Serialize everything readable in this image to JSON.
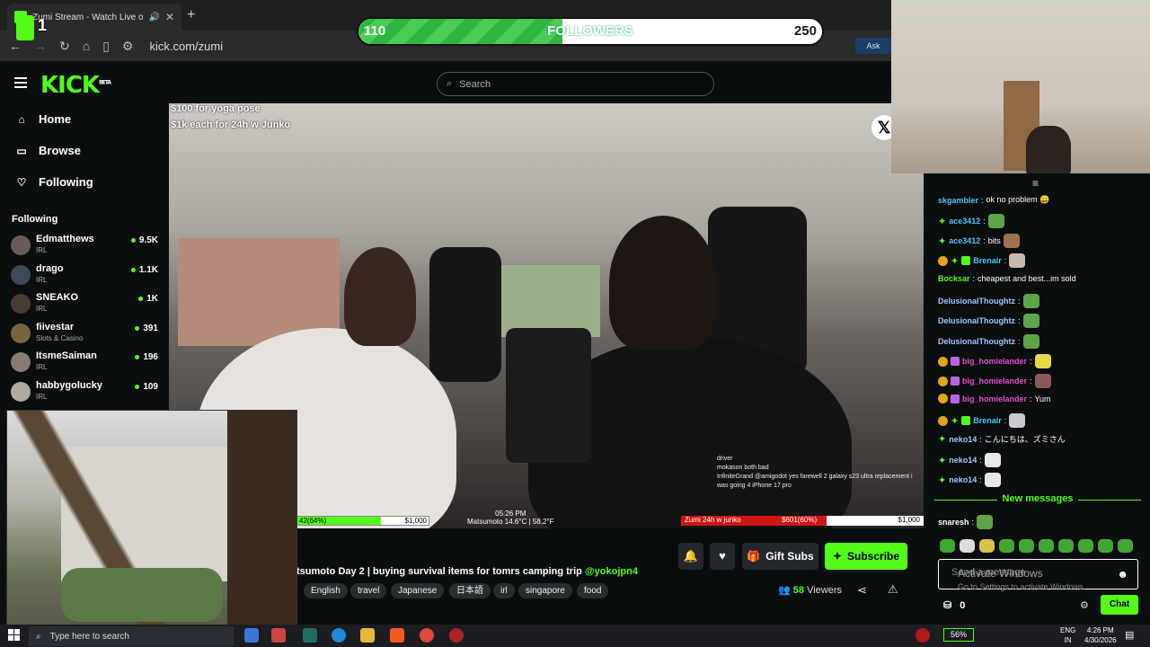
{
  "browser": {
    "tab_title": "Zumi Stream - Watch Live on Kick",
    "url": "kick.com/zumi",
    "ask_label": "Ask"
  },
  "followers_goal": {
    "current": "110",
    "label": "FOLLOWERS",
    "goal": "250",
    "progress_fraction": 0.44
  },
  "streamer_badge_number": "1",
  "kick": {
    "logo": "KICK",
    "logo_badge": "BETA",
    "search_placeholder": "Search",
    "nav": [
      {
        "label": "Home",
        "icon": "home-icon"
      },
      {
        "label": "Browse",
        "icon": "browse-icon"
      },
      {
        "label": "Following",
        "icon": "heart-icon"
      }
    ],
    "following_heading": "Following",
    "following": [
      {
        "name": "Edmatthews",
        "category": "IRL",
        "viewers": "9.5K"
      },
      {
        "name": "drago",
        "category": "IRL",
        "viewers": "1.1K"
      },
      {
        "name": "SNEAKO",
        "category": "IRL",
        "viewers": "1K"
      },
      {
        "name": "fiivestar",
        "category": "Slots & Casino",
        "viewers": "391"
      },
      {
        "name": "ItsmeSaiman",
        "category": "IRL",
        "viewers": "196"
      },
      {
        "name": "habbygolucky",
        "category": "IRL",
        "viewers": "109"
      }
    ]
  },
  "video_overlay": {
    "promo_line1": "$100 for yoga pose",
    "promo_line2": "$1k each for 24h w Junko",
    "left_bar_label": "42(64%)",
    "left_bar_amount": "$1,000",
    "left_bar_fraction": 0.64,
    "center_time": "05:26 PM",
    "center_weather": "Matsumoto 14.6°C | 58.2°F",
    "right_bar_label": "Zumi 24h w junko",
    "right_bar_value": "$601(60%)",
    "right_bar_amount": "$1,000",
    "right_bar_fraction": 0.6,
    "chat_lines": [
      "driver",
      "mokason  both bad",
      "InfiniteGrand  @amigodot yes farewell 2 galaxy s23 ultra replacement i was going 4 iPhone 17 pro"
    ]
  },
  "stream": {
    "title_prefix": "tsumoto Day 2 | buying survival items for tomrs camping trip ",
    "title_mention": "@yokojpn4",
    "tags": [
      "English",
      "travel",
      "Japanese",
      "日本語",
      "irl",
      "singapore",
      "food"
    ],
    "gift_subs_label": "Gift Subs",
    "subscribe_label": "Subscribe",
    "viewers_count": "58",
    "viewers_label": "Viewers"
  },
  "chat": {
    "messages": [
      {
        "user": "skgambler",
        "color": "#4fc3f7",
        "text": "ok no problem 😄"
      },
      {
        "user": "ace3412",
        "color": "#4fc3f7",
        "text": ""
      },
      {
        "user": "ace3412",
        "color": "#4fc3f7",
        "text": "bits"
      },
      {
        "user": "Brenair",
        "color": "#4fc3f7",
        "text": ""
      },
      {
        "user": "Bocksar",
        "color": "#53fc18",
        "text": "cheapest and best...im sold"
      },
      {
        "user": "DelusionalThoughtz",
        "color": "#a0c4ff",
        "text": ""
      },
      {
        "user": "DelusionalThoughtz",
        "color": "#a0c4ff",
        "text": ""
      },
      {
        "user": "DelusionalThoughtz",
        "color": "#a0c4ff",
        "text": ""
      },
      {
        "user": "big_homielander",
        "color": "#e14eca",
        "text": ""
      },
      {
        "user": "big_homielander",
        "color": "#e14eca",
        "text": ""
      },
      {
        "user": "big_homielander",
        "color": "#e14eca",
        "text": "Yum"
      },
      {
        "user": "Brenair",
        "color": "#4fc3f7",
        "text": ""
      },
      {
        "user": "neko14",
        "color": "#a0c4ff",
        "text": "こんにちは、ズミさん"
      },
      {
        "user": "neko14",
        "color": "#a0c4ff",
        "text": ""
      },
      {
        "user": "neko14",
        "color": "#a0c4ff",
        "text": ""
      }
    ],
    "new_messages_label": "New messages",
    "latest": {
      "user": "snaresh",
      "text": ""
    },
    "input_placeholder": "Send a message",
    "activate_windows": "Activate Windows",
    "activate_sub": "Go to Settings to activate Windows.",
    "points": "0",
    "chat_button": "Chat"
  },
  "taskbar": {
    "search_placeholder": "Type here to search",
    "battery": "56%",
    "lang_line1": "ENG",
    "lang_line2": "IN",
    "time": "4:26 PM",
    "date": "4/30/2026"
  }
}
